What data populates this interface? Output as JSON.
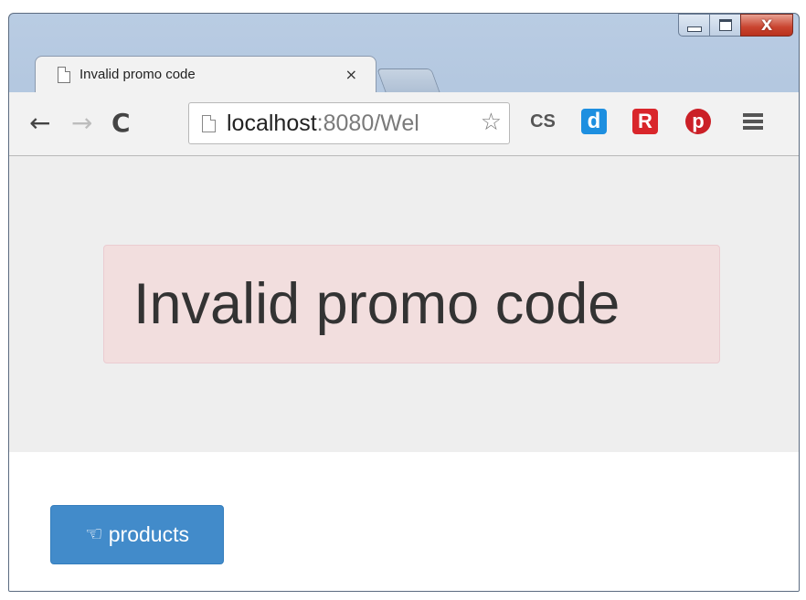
{
  "tab": {
    "title": "Invalid promo code",
    "close": "×"
  },
  "window_controls": {
    "close": "X"
  },
  "toolbar": {
    "back": "←",
    "forward": "→",
    "reload": "C",
    "url_host": "localhost",
    "url_rest": ":8080/Wel",
    "star": "☆",
    "extensions": [
      "CS",
      "d",
      "R",
      "p"
    ]
  },
  "page": {
    "alert_text": "Invalid promo code",
    "products_button": {
      "icon": "☜",
      "label": "products"
    }
  },
  "colors": {
    "alert_bg": "#f2dede",
    "button_bg": "#428bca",
    "jumbotron_bg": "#eeeeee"
  }
}
